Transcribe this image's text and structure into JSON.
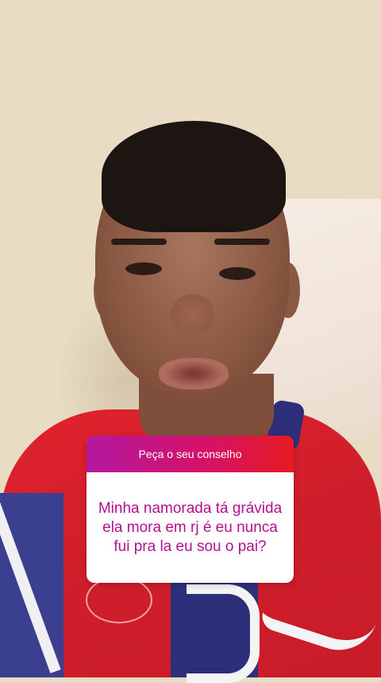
{
  "question_sticker": {
    "header": "Peça o seu conselho",
    "question": "Minha namorada tá grávida ela mora em rj é eu nunca fui pra la eu sou o pai?"
  },
  "colors": {
    "sticker_gradient_start": "#b3189f",
    "sticker_gradient_mid": "#d4126b",
    "sticker_gradient_end": "#e51a22",
    "question_text": "#b3108f"
  }
}
